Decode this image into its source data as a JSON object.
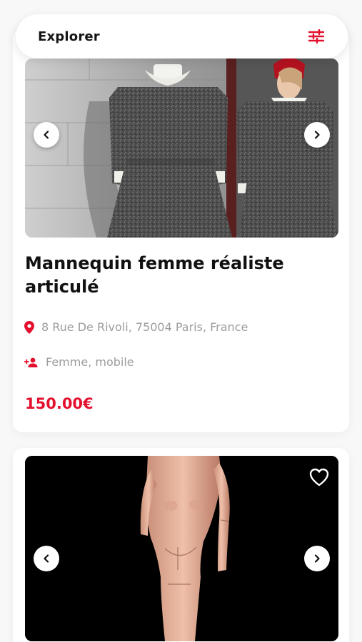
{
  "header": {
    "title": "Explorer",
    "filter_icon": "sliders-icon",
    "accent_color": "#e3102e"
  },
  "listings": [
    {
      "title": "Mannequin femme réaliste articulé",
      "location": "8 Rue De Rivoli, 75004 Paris, France",
      "category": "Femme, mobile",
      "price": "150.00€",
      "image": "Mannequins in grey tweed dresses",
      "prev_icon": "chevron-left-icon",
      "next_icon": "chevron-right-icon"
    },
    {
      "image": "Articulated mannequin on black background",
      "favorite_icon": "heart-icon",
      "prev_icon": "chevron-left-icon",
      "next_icon": "chevron-right-icon"
    }
  ]
}
